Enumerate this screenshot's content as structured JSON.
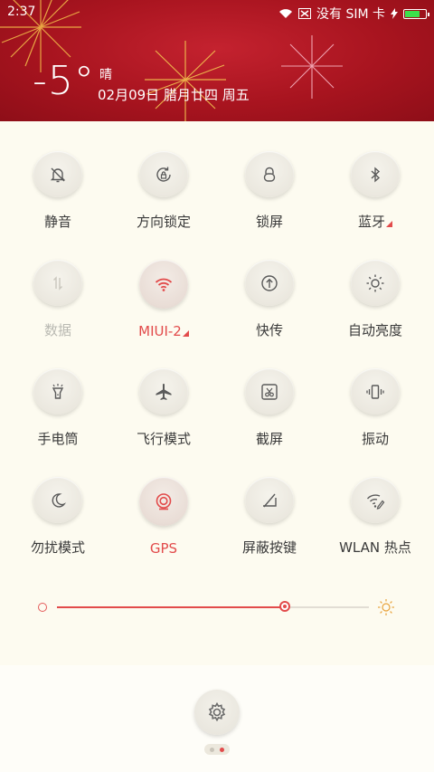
{
  "status_bar": {
    "time": "2:37",
    "carrier": "没有 SIM 卡",
    "battery_level": 0.75
  },
  "weather": {
    "temperature": "-5°",
    "condition": "晴",
    "date": "02月09日 腊月廿四 周五"
  },
  "toggles": [
    {
      "label": "静音",
      "icon": "bell-off-icon",
      "state": "off"
    },
    {
      "label": "方向锁定",
      "icon": "rotation-lock-icon",
      "state": "off"
    },
    {
      "label": "锁屏",
      "icon": "lock-icon",
      "state": "off"
    },
    {
      "label": "蓝牙",
      "icon": "bluetooth-icon",
      "state": "off",
      "has_menu": true
    },
    {
      "label": "数据",
      "icon": "data-arrows-icon",
      "state": "disabled"
    },
    {
      "label": "MIUI-2",
      "icon": "wifi-icon",
      "state": "on",
      "has_menu": true
    },
    {
      "label": "快传",
      "icon": "transfer-icon",
      "state": "off"
    },
    {
      "label": "自动亮度",
      "icon": "auto-brightness-icon",
      "state": "off"
    },
    {
      "label": "手电筒",
      "icon": "flashlight-icon",
      "state": "off"
    },
    {
      "label": "飞行模式",
      "icon": "airplane-icon",
      "state": "off"
    },
    {
      "label": "截屏",
      "icon": "screenshot-icon",
      "state": "off"
    },
    {
      "label": "振动",
      "icon": "vibrate-icon",
      "state": "off"
    },
    {
      "label": "勿扰模式",
      "icon": "moon-icon",
      "state": "off"
    },
    {
      "label": "GPS",
      "icon": "gps-icon",
      "state": "on"
    },
    {
      "label": "屏蔽按键",
      "icon": "block-keys-icon",
      "state": "off"
    },
    {
      "label": "WLAN 热点",
      "icon": "hotspot-icon",
      "state": "off"
    }
  ],
  "brightness": {
    "value": 0.73
  },
  "colors": {
    "accent": "#e24b4b",
    "header": "#b0151f",
    "background": "#fdfbf0"
  },
  "pager": {
    "pages": 2,
    "current": 2
  }
}
